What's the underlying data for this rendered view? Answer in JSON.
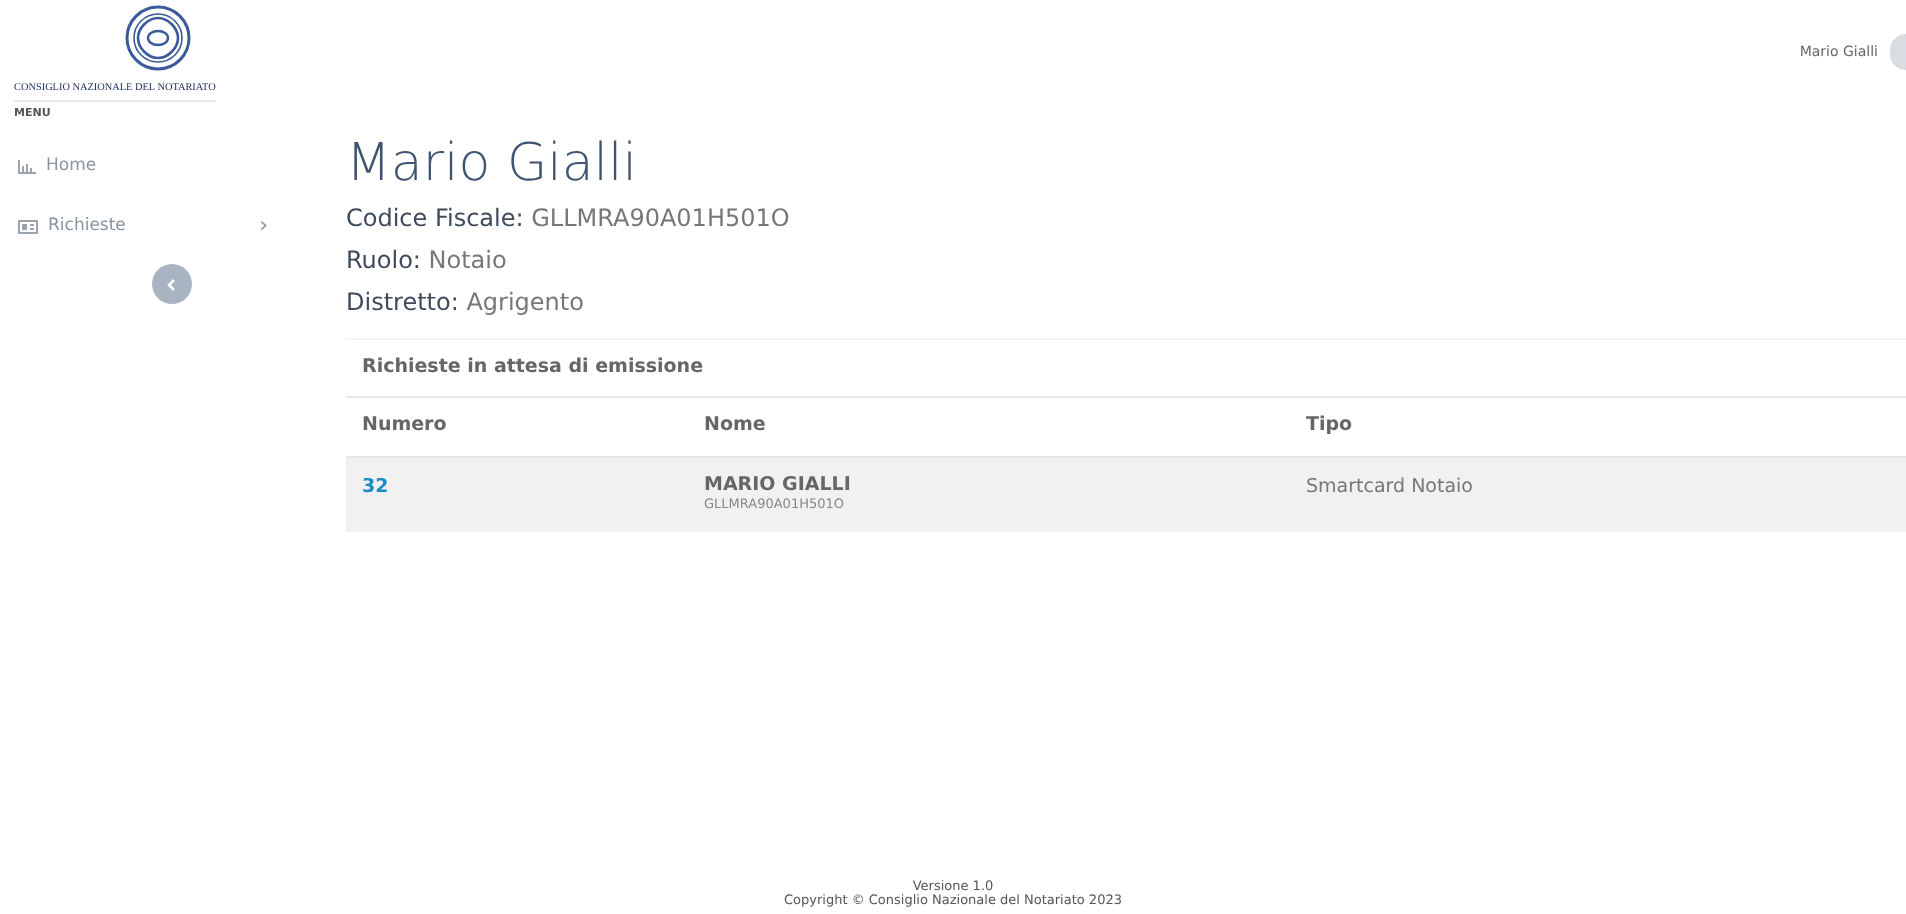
{
  "logo": {
    "caption": "CONSIGLIO NAZIONALE DEL NOTARIATO"
  },
  "sidebar": {
    "heading": "MENU",
    "items": [
      {
        "kind": "link",
        "label": "Home"
      },
      {
        "kind": "submenu",
        "label": "Richieste",
        "chevron": "›"
      }
    ]
  },
  "user": {
    "name": "Mario Gialli"
  },
  "profile": {
    "title": "Mario Gialli",
    "fields": [
      {
        "label": "Codice Fiscale:",
        "value": "GLLMRA90A01H501O"
      },
      {
        "label": "Ruolo:",
        "value": "Notaio"
      },
      {
        "label": "Distretto:",
        "value": "Agrigento"
      }
    ]
  },
  "table": {
    "title": "Richieste in attesa di emissione",
    "columns": [
      "Numero",
      "Nome",
      "Tipo"
    ],
    "rows": [
      {
        "numero": "32",
        "nome": "MARIO GIALLI",
        "codice": "GLLMRA90A01H501O",
        "tipo": "Smartcard Notaio"
      }
    ]
  },
  "footer": {
    "version": "Versione 1.0",
    "copyright": "Copyright © Consiglio Nazionale del Notariato 2023"
  }
}
